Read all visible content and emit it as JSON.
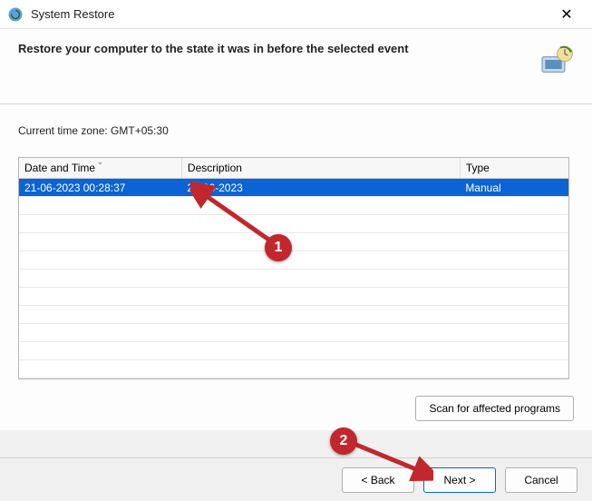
{
  "window": {
    "title": "System Restore"
  },
  "header": {
    "heading": "Restore your computer to the state it was in before the selected event"
  },
  "timezone_label": "Current time zone: GMT+05:30",
  "table": {
    "columns": {
      "datetime": "Date and Time",
      "description": "Description",
      "type": "Type"
    },
    "rows": [
      {
        "datetime": "21-06-2023 00:28:37",
        "description": "21-06-2023",
        "type": "Manual",
        "selected": true
      }
    ]
  },
  "buttons": {
    "scan": "Scan for affected programs",
    "back": "< Back",
    "next": "Next >",
    "cancel": "Cancel"
  },
  "annotations": {
    "callout1": "1",
    "callout2": "2"
  }
}
